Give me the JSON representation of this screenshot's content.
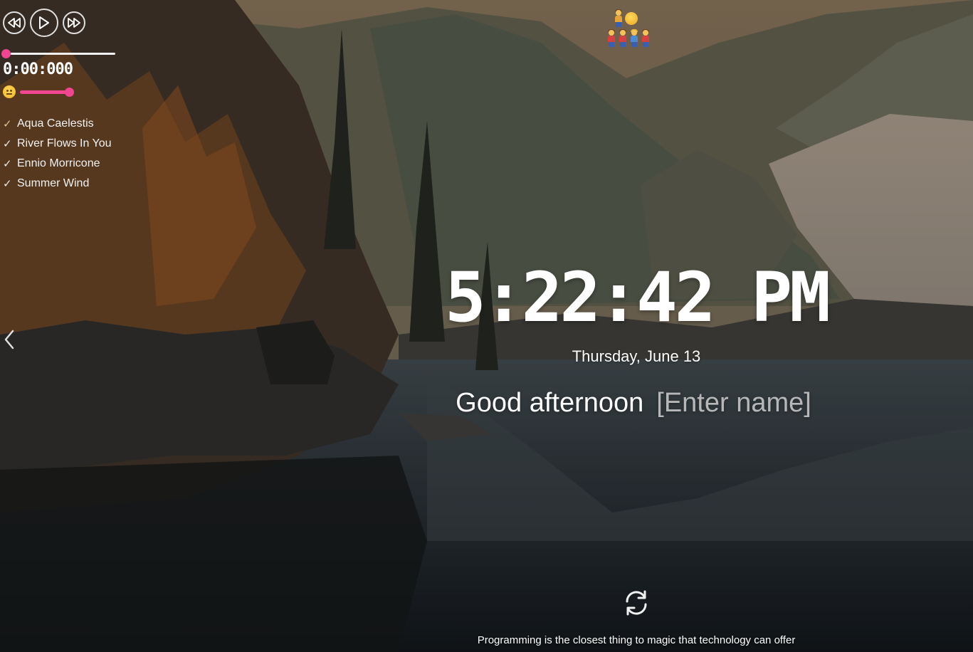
{
  "player": {
    "time": "0:00:000",
    "progress": 0,
    "volume": 1.0,
    "icons": {
      "prev": "rewind-icon",
      "play": "play-icon",
      "next": "fast-forward-icon",
      "volume": "emoji-volume-icon"
    },
    "accent": "#f0458f",
    "playlist": [
      {
        "title": "Aqua Caelestis",
        "checked": true
      },
      {
        "title": "River Flows In You",
        "checked": true
      },
      {
        "title": "Ennio Morricone",
        "checked": true
      },
      {
        "title": "Summer Wind",
        "checked": true
      }
    ]
  },
  "clock": {
    "time": "5:22:42 PM",
    "date": "Thursday, June 13"
  },
  "greeting": {
    "text": "Good afternoon",
    "name_placeholder": "[Enter name]"
  },
  "quote": "Programming is the closest thing to magic that technology can offer",
  "icons": {
    "left_nav": "chevron-left-icon",
    "refresh": "refresh-icon"
  }
}
